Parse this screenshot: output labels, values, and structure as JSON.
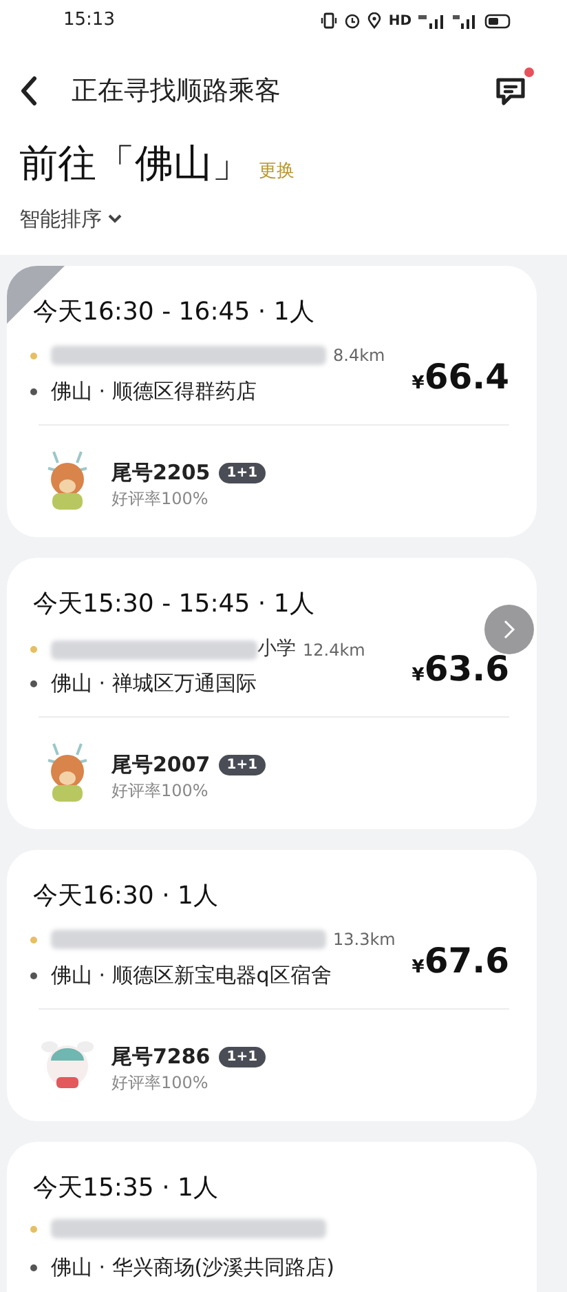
{
  "status_bar": {
    "time": "15:13",
    "network_label": "HD"
  },
  "header": {
    "title": "正在寻找顺路乘客",
    "message_unread": true
  },
  "destination": {
    "title": "前往「佛山」",
    "change_link": "更换"
  },
  "sort": {
    "label": "智能排序"
  },
  "orders": [
    {
      "viewed": true,
      "time": "今天16:30 - 16:45 · 1人",
      "origin_blurred": true,
      "distance": "8.4km",
      "destination": "佛山 · 顺德区得群药店",
      "price_symbol": "¥",
      "price": "66.4",
      "passenger": "尾号2205",
      "badge": "1+1",
      "rating": "好评率100%",
      "avatar": {
        "kind": "deer"
      }
    },
    {
      "viewed": false,
      "time": "今天15:30 - 15:45 · 1人",
      "origin_blurred": true,
      "origin_tail": "小学",
      "distance": "12.4km",
      "destination": "佛山 · 禅城区万通国际",
      "price_symbol": "¥",
      "price": "63.6",
      "passenger": "尾号2007",
      "badge": "1+1",
      "rating": "好评率100%",
      "avatar": {
        "kind": "deer"
      }
    },
    {
      "viewed": false,
      "time": "今天16:30 · 1人",
      "origin_blurred": true,
      "distance": "13.3km",
      "destination": "佛山 · 顺德区新宝电器q区宿舍",
      "price_symbol": "¥",
      "price": "67.6",
      "passenger": "尾号7286",
      "badge": "1+1",
      "rating": "好评率100%",
      "avatar": {
        "kind": "bunny"
      }
    },
    {
      "viewed": false,
      "time": "今天15:35 · 1人",
      "origin_blurred": true,
      "destination": "佛山 · 华兴商场(沙溪共同路店)"
    }
  ],
  "floating_button": {
    "visible": true
  }
}
